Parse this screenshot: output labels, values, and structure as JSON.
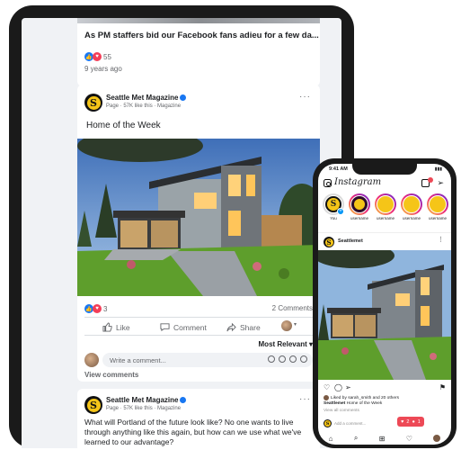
{
  "facebook": {
    "prev_post": {
      "headline": "As PM staffers bid our Facebook fans adieu for a few da...",
      "reaction_count": "55",
      "time": "9 years ago"
    },
    "post": {
      "page_name": "Seattle Met Magazine",
      "page_sub": "Page · 57K like this · Magazine",
      "text": "Home of the Week",
      "reaction_count": "3",
      "comments_count": "2 Comments",
      "actions": {
        "like": "Like",
        "comment": "Comment",
        "share": "Share"
      },
      "sort_label": "Most Relevant",
      "comment_placeholder": "Write a comment...",
      "view_comments": "View comments"
    },
    "next_post": {
      "page_name": "Seattle Met Magazine",
      "page_sub": "Page · 57K like this · Magazine",
      "text": "What will Portland of the future look like? No one wants to live through anything like this again, but how can we use what we've learned to our advantage?"
    }
  },
  "instagram": {
    "status_time": "9:41 AM",
    "logo": "Instagram",
    "stories": [
      {
        "label": "You"
      },
      {
        "label": "username"
      },
      {
        "label": "username"
      },
      {
        "label": "username"
      },
      {
        "label": "username"
      }
    ],
    "post": {
      "username": "Seattlemet",
      "liked_by": "Liked by sarah_smith and 20 others",
      "caption_user": "Seattlemet",
      "caption": "Home of the Week",
      "view_comments": "View all comments",
      "add_comment": "Add a comment...",
      "notif_likes": "2",
      "notif_comments": "1"
    }
  },
  "colors": {
    "fb_blue": "#1877f2",
    "ig_red": "#ed4956",
    "brand_yellow": "#f5c518"
  }
}
